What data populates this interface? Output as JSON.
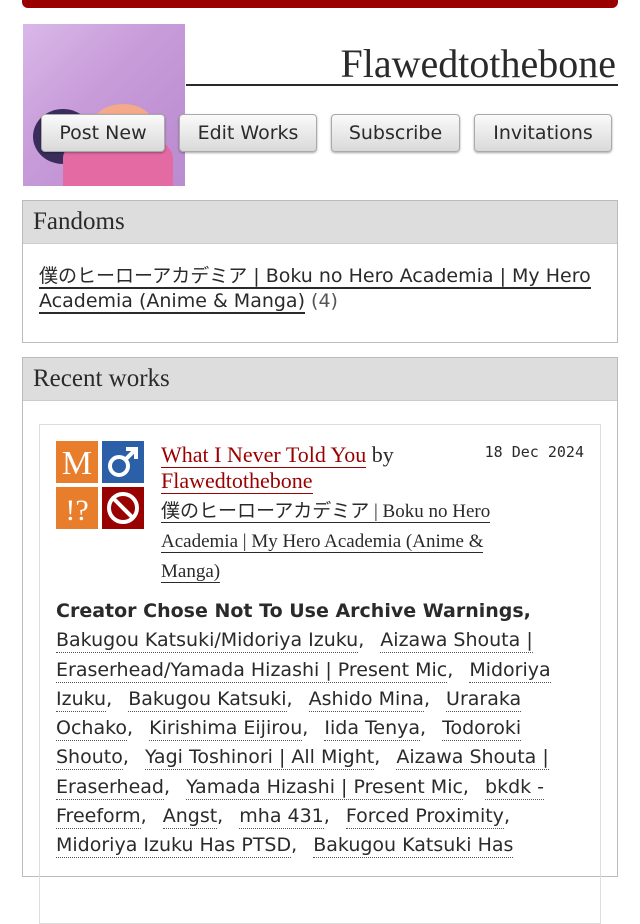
{
  "profile": {
    "username": "Flawedtothebone",
    "buttons": [
      "Post New",
      "Edit Works",
      "Subscribe",
      "Invitations"
    ]
  },
  "fandoms": {
    "heading": "Fandoms",
    "items": [
      {
        "name": "僕のヒーローアカデミア | Boku no Hero Academia | My Hero Academia (Anime & Manga)",
        "count": "(4)"
      }
    ]
  },
  "recent": {
    "heading": "Recent works",
    "works": [
      {
        "title": "What I Never Told You",
        "by": "by",
        "author": "Flawedtothebone",
        "date": "18 Dec 2024",
        "fandom": "僕のヒーローアカデミア | Boku no Hero Academia | My Hero Academia (Anime & Manga)",
        "warning": "Creator Chose Not To Use Archive Warnings,",
        "tags": [
          "Bakugou Katsuki/Midoriya Izuku",
          "Aizawa Shouta | Eraserhead/Yamada Hizashi | Present Mic",
          "Midoriya Izuku",
          "Bakugou Katsuki",
          "Ashido Mina",
          "Uraraka Ochako",
          "Kirishima Eijirou",
          "Iida Tenya",
          "Todoroki Shouto",
          "Yagi Toshinori | All Might",
          "Aizawa Shouta | Eraserhead",
          "Yamada Hizashi | Present Mic",
          "bkdk - Freeform",
          "Angst",
          "mha 431",
          "Forced Proximity",
          "Midoriya Izuku Has PTSD",
          "Bakugou Katsuki Has"
        ],
        "required_tags": [
          {
            "symbol": "M",
            "meaning": "mature-rating",
            "color": "#e87d2c"
          },
          {
            "symbol": "♂",
            "meaning": "mm-category",
            "color": "#2b5fa8"
          },
          {
            "symbol": "!?",
            "meaning": "choose-not-to-warn",
            "color": "#e87d2c"
          },
          {
            "symbol": "⊘",
            "meaning": "not-complete",
            "color": "#990000"
          }
        ]
      }
    ]
  }
}
